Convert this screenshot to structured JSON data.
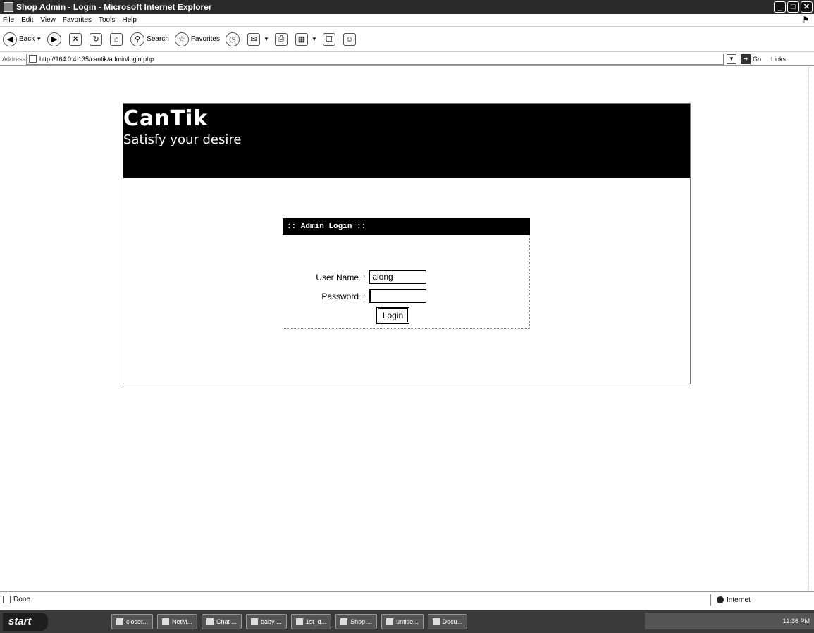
{
  "window": {
    "title": "Shop Admin - Login - Microsoft Internet Explorer"
  },
  "menu": {
    "items": [
      "File",
      "Edit",
      "View",
      "Favorites",
      "Tools",
      "Help"
    ]
  },
  "toolbar": {
    "back_label": "Back",
    "search_label": "Search",
    "favorites_label": "Favorites"
  },
  "address": {
    "label": "Address",
    "url": "http://164.0.4.135/cantik/admin/login.php",
    "go_label": "Go",
    "links_label": "Links"
  },
  "site": {
    "logo": "CanTik",
    "tagline": "Satisfy your desire"
  },
  "login": {
    "header": ":: Admin Login ::",
    "username_label": "User Name",
    "username_value": "along",
    "password_label": "Password",
    "password_value": "",
    "separator": ":",
    "button_label": "Login"
  },
  "status": {
    "text": "Done",
    "zone": "Internet"
  },
  "taskbar": {
    "start_label": "start",
    "tasks": [
      "closer...",
      "NetM...",
      "Chat ...",
      "baby ...",
      "1st_d...",
      "Shop ...",
      "untitle...",
      "Docu..."
    ],
    "clock": "12:36 PM"
  }
}
